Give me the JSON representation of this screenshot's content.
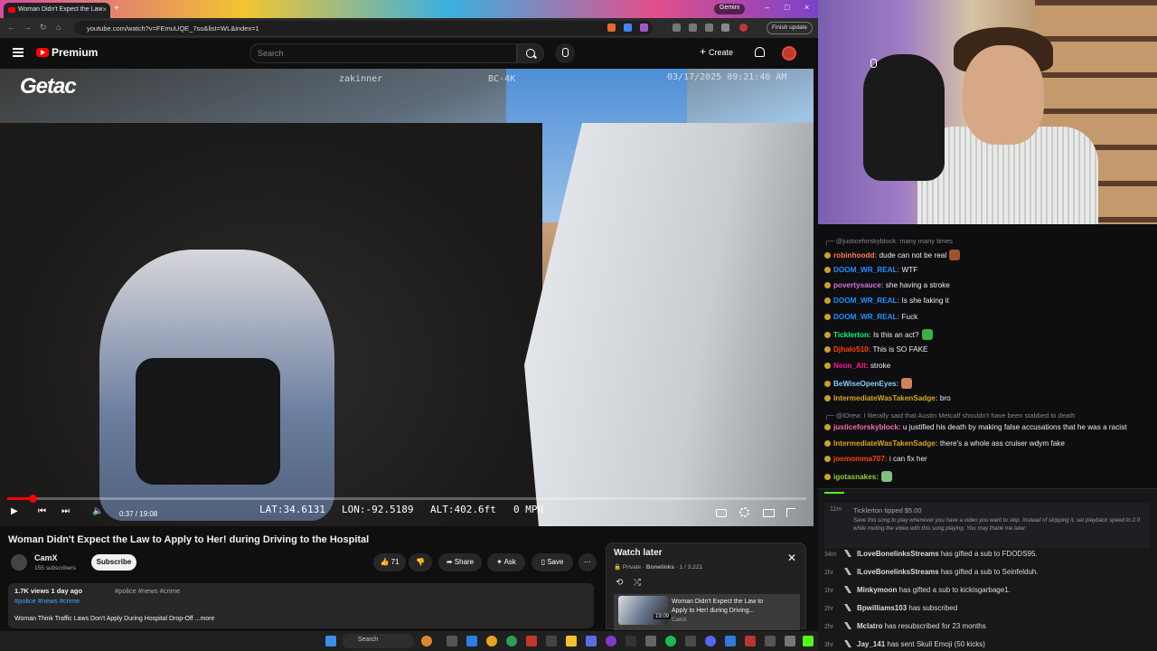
{
  "browser": {
    "tab_title": "Woman Didn't Expect the Law",
    "url": "youtube.com/watch?v=FEmuUQE_7so&list=WL&index=1",
    "gemini_label": "Gemini",
    "finish_update": "Finish update"
  },
  "youtube": {
    "brand": "Premium",
    "search_placeholder": "Search",
    "create_label": "Create"
  },
  "video": {
    "watermark": "Getac",
    "overlay_user": "zakinner",
    "overlay_cam": "BC-4K",
    "overlay_datetime": "03/17/2025 09:21:46 AM",
    "lat": "LAT:34.6131",
    "lon": "LON:-92.5189",
    "alt": "ALT:402.6ft",
    "speed": "0 MPH",
    "timecode": "0:37 / 19:08",
    "progress": 0.032
  },
  "info": {
    "title": "Woman Didn't Expect the Law to Apply to Her! during Driving to the Hospital",
    "channel": "CamX",
    "subscribers": "155 subscribers",
    "subscribe_label": "Subscribe",
    "likes": "71",
    "share_label": "Share",
    "ask_label": "Ask",
    "save_label": "Save",
    "views_date": "1.7K views  1 day ago",
    "tags_line1": "#police #news #crime",
    "tags_line2": "#police #news #crime",
    "desc_line": "Woman Think Traffic Laws Don't Apply During Hospital Drop-Off ...more"
  },
  "watch_later": {
    "title": "Watch later",
    "privacy": "Private",
    "owner": "Bonelinks",
    "position": "1 / 3,221",
    "item_title": "Woman Didn't Expect the Law to Apply to Her! during Driving...",
    "item_channel": "CamX",
    "item_duration": "19:09"
  },
  "chat": {
    "messages": [
      {
        "reply": "@justiceforskyblock: many many times"
      },
      {
        "user": "robinhoodd:",
        "color": "#ff7f50",
        "text": " dude can not be real",
        "emote": "#a0522d"
      },
      {
        "user": "DOOM_WR_REAL:",
        "color": "#1e90ff",
        "text": " WTF"
      },
      {
        "user": "povertysauce:",
        "color": "#da70d6",
        "text": " she having a stroke"
      },
      {
        "user": "DOOM_WR_REAL:",
        "color": "#1e90ff",
        "text": " Is she faking it"
      },
      {
        "user": "DOOM_WR_REAL:",
        "color": "#1e90ff",
        "text": " Fuck"
      },
      {
        "user": "Ticklerton:",
        "color": "#00ff7f",
        "text": " Is this an act?",
        "emote": "#3cb043"
      },
      {
        "user": "Djhalo510:",
        "color": "#ff4500",
        "text": " This is SO FAKE"
      },
      {
        "user": "Neon_Alt:",
        "color": "#ff1493",
        "text": " stroke"
      },
      {
        "user": "BeWiseOpenEyes:",
        "color": "#87cefa",
        "text": "",
        "emote": "#d2825a"
      },
      {
        "user": "IntermediateWasTakenSadge:",
        "color": "#daa520",
        "text": " bro"
      },
      {
        "reply": "@iDrew: I literally said that Austin Metcalf shouldn't have been stabbed to death"
      },
      {
        "user": "justiceforskyblock:",
        "color": "#ff69b4",
        "text": " u justified his death by making false accusations that he was a racist"
      },
      {
        "user": "IntermediateWasTakenSadge:",
        "color": "#daa520",
        "text": " there's a whole ass cruiser wdym fake"
      },
      {
        "user": "joemomma707:",
        "color": "#ff4500",
        "text": " i can fix her"
      },
      {
        "user": "igotasnakes:",
        "color": "#9acd32",
        "text": "",
        "emote": "#7fbf7f"
      }
    ]
  },
  "events": {
    "tip": {
      "time": "11m",
      "header": "Ticklerton tipped $5.00",
      "message": "Save this song to play whenever you have a video you want to skip. Instead of skipping it, set playback speed to 2.0 while muting the video with this song playing. You may thank me later:"
    },
    "items": [
      {
        "time": "34m",
        "user": "ILoveBonelinksStreams",
        "text": " has gifted a sub to FDODS95."
      },
      {
        "time": "1hr",
        "user": "ILoveBonelinksStreams",
        "text": " has gifted a sub to Seinfelduh."
      },
      {
        "time": "1hr",
        "user": "Minkymoon",
        "text": " has gifted a sub to kickisgarbage1."
      },
      {
        "time": "2hr",
        "user": "Bpwilliams103",
        "text": " has subscribed"
      },
      {
        "time": "2hr",
        "user": "Mclatro",
        "text": " has resubscribed for 23 months"
      },
      {
        "time": "3hr",
        "user": "Jay_141",
        "text": " has sent Skull Emoji (50 kicks)"
      }
    ]
  },
  "taskbar": {
    "search_label": "Search"
  }
}
